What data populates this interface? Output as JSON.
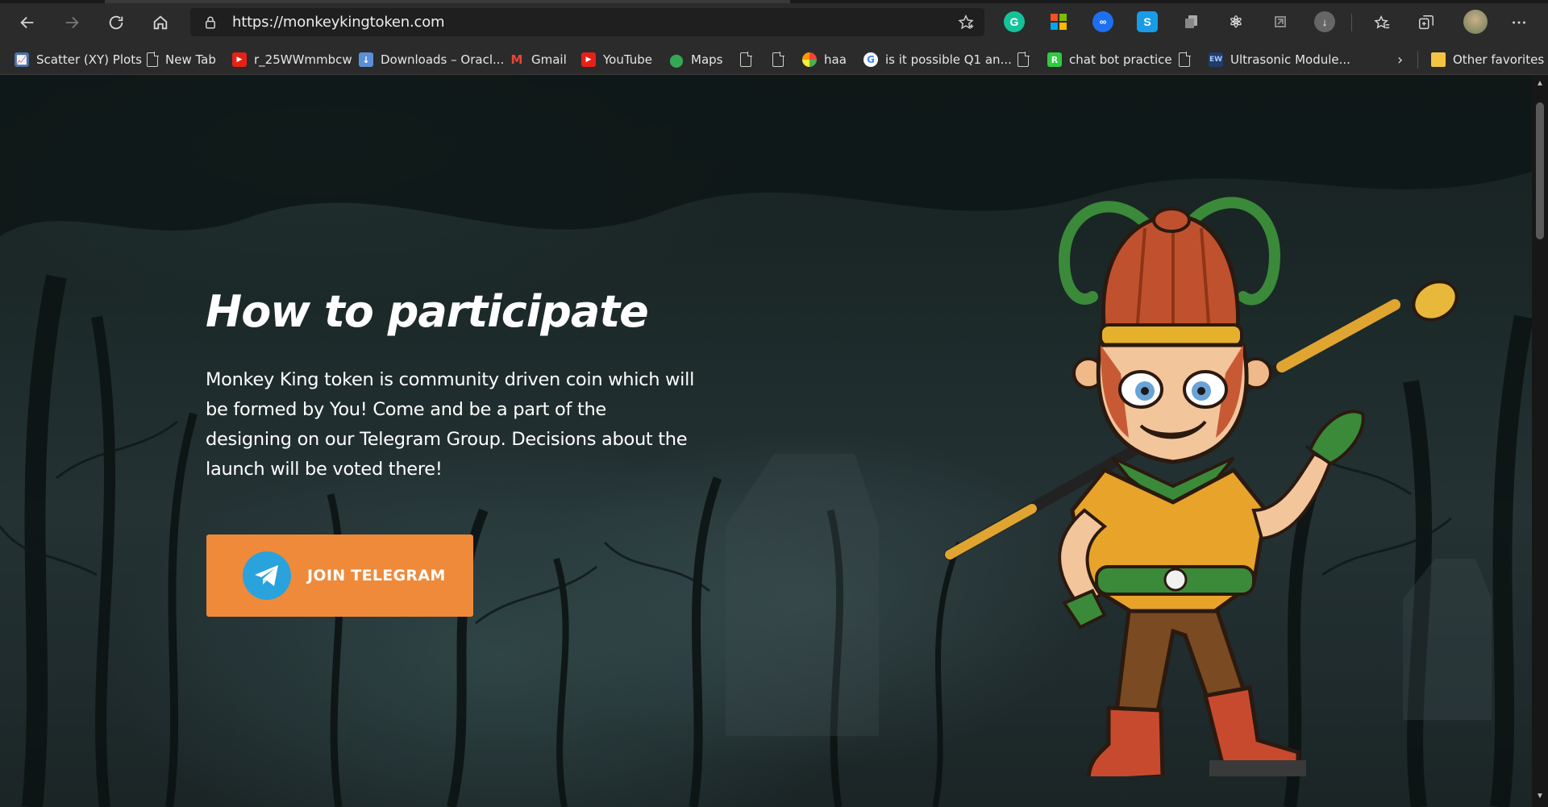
{
  "browser": {
    "url": "https://monkeykingtoken.com",
    "bookmarks": [
      {
        "label": "Scatter (XY) Plots",
        "icon": "chart-icon"
      },
      {
        "label": "New Tab",
        "icon": "page-icon"
      },
      {
        "label": "r_25WWmmbcw",
        "icon": "youtube-icon"
      },
      {
        "label": "Downloads – Oracl...",
        "icon": "downloads-icon"
      },
      {
        "label": "Gmail",
        "icon": "gmail-icon"
      },
      {
        "label": "YouTube",
        "icon": "youtube-icon"
      },
      {
        "label": "Maps",
        "icon": "maps-icon"
      },
      {
        "label": "",
        "icon": "page-icon"
      },
      {
        "label": "",
        "icon": "page-icon"
      },
      {
        "label": "haa",
        "icon": "colorful-icon"
      },
      {
        "label": "is it possible Q1 an...",
        "icon": "google-icon"
      },
      {
        "label": "",
        "icon": "page-icon"
      },
      {
        "label": "chat bot practice",
        "icon": "replit-icon"
      },
      {
        "label": "",
        "icon": "page-icon"
      },
      {
        "label": "Ultrasonic Module...",
        "icon": "site-icon"
      }
    ],
    "other_favorites": "Other favorites"
  },
  "hero": {
    "heading": "How to participate",
    "description": "Monkey King token is community driven coin which will be formed by You! Come and be a part of the designing on our Telegram Group. Decisions about the launch will be voted there!",
    "button_label": "JOIN TELEGRAM"
  },
  "colors": {
    "accent": "#ef8a3a",
    "telegram": "#2aa2dc"
  }
}
